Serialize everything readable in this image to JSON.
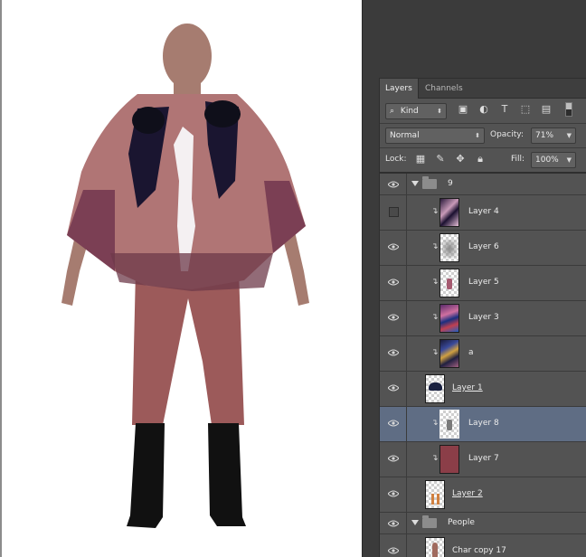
{
  "panel": {
    "tabs": [
      {
        "label": "Layers",
        "active": true
      },
      {
        "label": "Channels",
        "active": false
      }
    ],
    "filter": {
      "kind_label": "Kind",
      "icons": [
        "image-filter-icon",
        "adjustment-filter-icon",
        "type-filter-icon",
        "shape-filter-icon",
        "smart-object-filter-icon",
        "filter-toggle-icon"
      ]
    },
    "blend_mode": "Normal",
    "opacity_label": "Opacity:",
    "opacity_value": "71%",
    "lock_label": "Lock:",
    "fill_label": "Fill:",
    "fill_value": "100%",
    "layers": [
      {
        "name": "9",
        "type": "group",
        "visible": true
      },
      {
        "name": "Layer 4",
        "visible": false,
        "clipped": true,
        "thumb": "pattern-purple"
      },
      {
        "name": "Layer 6",
        "visible": true,
        "clipped": true,
        "thumb": "gray-blur"
      },
      {
        "name": "Layer 5",
        "visible": true,
        "clipped": true,
        "thumb": "small-figure"
      },
      {
        "name": "Layer 3",
        "visible": true,
        "clipped": true,
        "thumb": "pattern-multicolor"
      },
      {
        "name": "a",
        "visible": true,
        "clipped": true,
        "thumb": "pattern-dark"
      },
      {
        "name": "Layer 1",
        "visible": true,
        "clipped": false,
        "thumb": "navy-shape",
        "underlined": true
      },
      {
        "name": "Layer 8",
        "visible": true,
        "clipped": true,
        "thumb": "small-figure-gray",
        "selected": true
      },
      {
        "name": "Layer 7",
        "visible": true,
        "clipped": true,
        "thumb": "solid-maroon"
      },
      {
        "name": "Layer 2",
        "visible": true,
        "clipped": false,
        "thumb": "orange-legs",
        "underlined": true
      },
      {
        "name": "People",
        "type": "group",
        "visible": true
      },
      {
        "name": "Char copy 17",
        "visible": true,
        "clipped": false,
        "thumb": "figure"
      }
    ]
  },
  "colors": {
    "panel_bg": "#535353",
    "selected_row": "#5f6d84",
    "poncho": "#b07575",
    "pants": "#9c5a5a",
    "skin": "#a67c70",
    "boots": "#111111",
    "layer7_swatch": "#8b3e48"
  }
}
